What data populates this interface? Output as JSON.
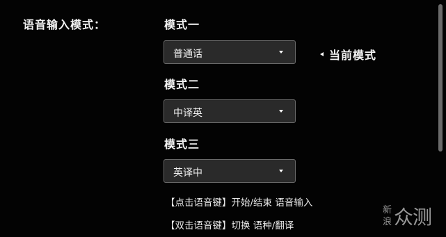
{
  "settings": {
    "label": "语音输入模式："
  },
  "modes": [
    {
      "title": "模式一",
      "value": "普通话"
    },
    {
      "title": "模式二",
      "value": "中译英"
    },
    {
      "title": "模式三",
      "value": "英译中"
    }
  ],
  "current_marker": {
    "label": "当前模式"
  },
  "hints": [
    "【点击语音键】开始/结束 语音输入",
    "【双击语音键】切换 语种/翻译"
  ],
  "watermark": {
    "side_top": "新",
    "side_bottom": "浪",
    "main": "众测"
  },
  "icons": {
    "dropdown": "caret-down-icon",
    "marker": "triangle-left-icon"
  },
  "colors": {
    "background": "#030303",
    "select_bg": "#2a2a2a",
    "select_border": "#6a6a6a",
    "text": "#f2f2f2"
  }
}
